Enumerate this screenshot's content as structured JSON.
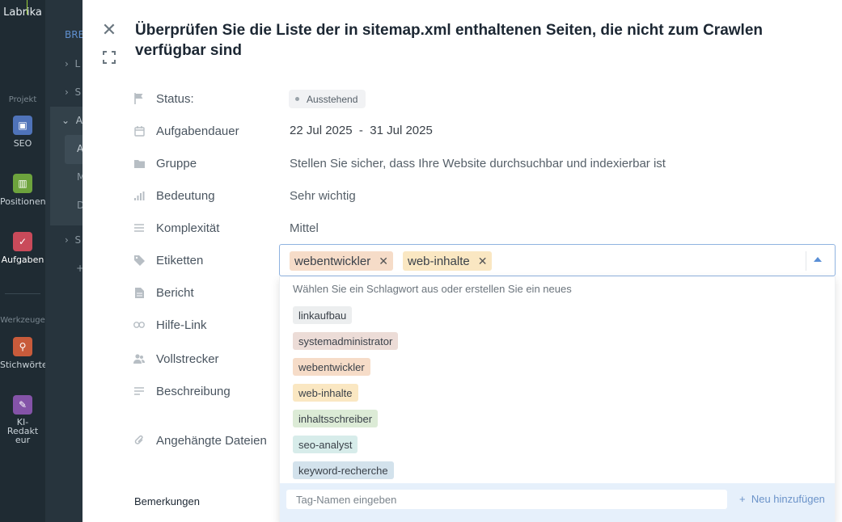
{
  "sidebar": {
    "logo": "Labrika",
    "section_project": "Projekt",
    "section_tools": "Werkzeuge",
    "items": [
      {
        "label": "SEO",
        "color": "#4f73b9"
      },
      {
        "label": "Positionen",
        "color": "#6da33d"
      },
      {
        "label": "Aufgaben",
        "color": "#c94a5a"
      },
      {
        "label": "Stichwörter",
        "color": "#c85b3b"
      },
      {
        "label": "KI-Redakteur",
        "color": "#8453a8"
      }
    ]
  },
  "tree": {
    "crumb": "BRE",
    "rows": [
      "L",
      "S",
      "A",
      "A",
      "M",
      "D",
      "S",
      "+"
    ]
  },
  "task": {
    "title": "Überprüfen Sie die Liste der in sitemap.xml enthaltenen Seiten, die nicht zum Crawlen verfügbar sind",
    "fields": {
      "status_label": "Status:",
      "status_value": "Ausstehend",
      "duration_label": "Aufgabendauer",
      "duration_start": "22 Jul 2025",
      "duration_sep": "-",
      "duration_end": "31 Jul 2025",
      "group_label": "Gruppe",
      "group_value": "Stellen Sie sicher, dass Ihre Website durchsuchbar und indexierbar ist",
      "importance_label": "Bedeutung",
      "importance_value": "Sehr wichtig",
      "complexity_label": "Komplexität",
      "complexity_value": "Mittel",
      "tags_label": "Etiketten",
      "report_label": "Bericht",
      "help_label": "Hilfe-Link",
      "executor_label": "Vollstrecker",
      "description_label": "Beschreibung",
      "attachments_label": "Angehängte Dateien"
    },
    "remarks_label": "Bemerkungen"
  },
  "tags": {
    "selected": [
      {
        "label": "webentwickler",
        "color": "#f6dcc8"
      },
      {
        "label": "web-inhalte",
        "color": "#fae7c2"
      }
    ],
    "dropdown_hint": "Wählen Sie ein Schlagwort aus oder erstellen Sie ein neues",
    "options": [
      {
        "label": "linkaufbau",
        "color": "#eceeef"
      },
      {
        "label": "systemadministrator",
        "color": "#ecdcd7"
      },
      {
        "label": "webentwickler",
        "color": "#f6dcc8"
      },
      {
        "label": "web-inhalte",
        "color": "#fae7c2"
      },
      {
        "label": "inhaltsschreiber",
        "color": "#dcebd6"
      },
      {
        "label": "seo-analyst",
        "color": "#d7ecea"
      },
      {
        "label": "keyword-recherche",
        "color": "#d3e2ec"
      }
    ],
    "input_placeholder": "Tag-Namen eingeben",
    "add_label": "Neu hinzufügen"
  }
}
